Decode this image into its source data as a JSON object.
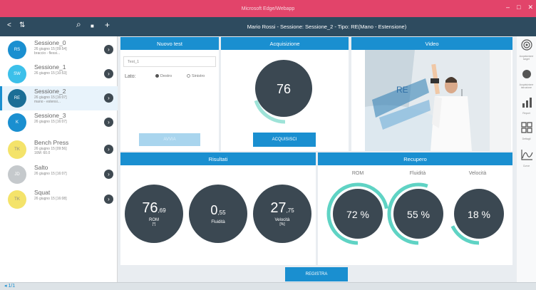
{
  "window": {
    "title": "Microsoft Edge/Webapp",
    "controls": [
      "–",
      "□",
      "✕"
    ]
  },
  "sidebar_header": {
    "icons": [
      "back-arrow-icon",
      "sort-icon",
      "search-icon",
      "delete-icon",
      "add-icon"
    ],
    "glyphs": {
      "back": "<",
      "sort": "⇅",
      "search": "⌕",
      "delete": "■",
      "add": "+"
    }
  },
  "header": {
    "title": "Mario Rossi - Sessione: Sessione_2 - Tipo: RE(Mano - Estensione)"
  },
  "sessions": [
    {
      "initials": "RS",
      "name": "Sessione_0",
      "date": "26 giugno 15 [09:54]",
      "note": "braccio - flessi...",
      "color": "#1a8fd0"
    },
    {
      "initials": "SW",
      "name": "Sessione_1",
      "date": "26 giugno 15 [10:53]",
      "note": "",
      "color": "#3cc0ea"
    },
    {
      "initials": "RE",
      "name": "Sessione_2",
      "date": "26 giugno 15 [16:07]",
      "note": "mano - estensi...",
      "color": "#1b6e96"
    },
    {
      "initials": "K",
      "name": "Sessione_3",
      "date": "26 giugno 15 [16:07]",
      "note": "",
      "color": "#1a8fd0"
    },
    {
      "initials": "TK",
      "name": "Bench Press",
      "date": "26 giugno 15 [09:56]",
      "note": "16M: 60.0",
      "color": "#f4e36a"
    },
    {
      "initials": "JD",
      "name": "Salto",
      "date": "26 giugno 15 [16:07]",
      "note": "",
      "color": "#c5c9cc"
    },
    {
      "initials": "TK",
      "name": "Squat",
      "date": "26 giugno 15 [16:08]",
      "note": "",
      "color": "#f4e36a"
    }
  ],
  "nuovo_test": {
    "title": "Nuovo test",
    "name_value": "Test_1",
    "lato_label": "Lato:",
    "options": [
      "Destro",
      "Sinistro"
    ],
    "selected": "Destro",
    "button": "AVVIA"
  },
  "acquisizione": {
    "title": "Acquisizione",
    "value": "76",
    "progress": 0.2,
    "button": "ACQUISISCI"
  },
  "video": {
    "title": "Video",
    "wall_text": "RE"
  },
  "risultati": {
    "title": "Risultati",
    "metrics": [
      {
        "value": "76",
        "decimals": ",69",
        "label": "ROM",
        "unit": "[°]"
      },
      {
        "value": "0",
        "decimals": ",55",
        "label": "Fluidità",
        "unit": ""
      },
      {
        "value": "27",
        "decimals": ",75",
        "label": "Velocità",
        "unit": "[%]"
      }
    ]
  },
  "recupero": {
    "title": "Recupero",
    "items": [
      {
        "label": "ROM",
        "value": "72 %",
        "fraction": 0.72
      },
      {
        "label": "Fluidità",
        "value": "55 %",
        "fraction": 0.55
      },
      {
        "label": "Velocità",
        "value": "18 %",
        "fraction": 0.18
      }
    ]
  },
  "footer": {
    "button": "REGISTRA",
    "left_text": "◂ 1/1"
  },
  "right_toolbar": [
    {
      "icon": "target-icon",
      "label": "Acquisizione target"
    },
    {
      "icon": "record-icon",
      "label": "Acquisizione istruzione"
    },
    {
      "icon": "bar-chart-icon",
      "label": "Report"
    },
    {
      "icon": "grid-icon",
      "label": "Dettagli"
    },
    {
      "icon": "curve-icon",
      "label": "Curve"
    }
  ],
  "colors": {
    "accent": "#1a8fd0",
    "header": "#2e4b5f",
    "title_bar": "#e2446a",
    "dark_circle": "#3b4852",
    "ring": "#5fd3c4"
  }
}
